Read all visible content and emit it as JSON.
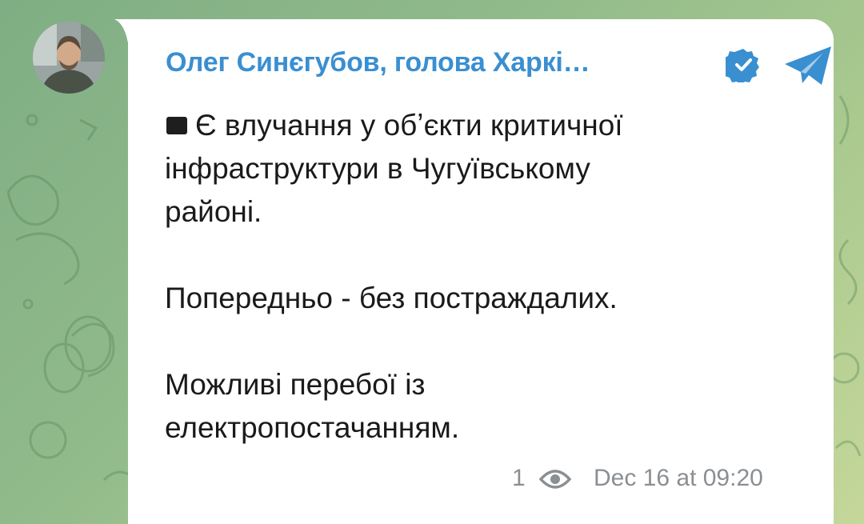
{
  "channel": {
    "name": "Олег Синєгубов, голова Харкі…",
    "avatar_icon": "person-photo",
    "verified_icon": "verified-badge-icon",
    "telegram_icon": "telegram-plane-icon",
    "name_color": "#3a8fd1"
  },
  "message": {
    "line1": "Є влучання у обʼєкти критичної",
    "line2": "інфраструктури в Чугуївському",
    "line3": "районі.",
    "line4": "Попередньо - без постраждалих.",
    "line5": "Можливі перебої із",
    "line6": "електропостачанням."
  },
  "footer": {
    "views": "1",
    "timestamp": "Dec 16 at 09:20",
    "eye_icon": "eye-icon"
  }
}
